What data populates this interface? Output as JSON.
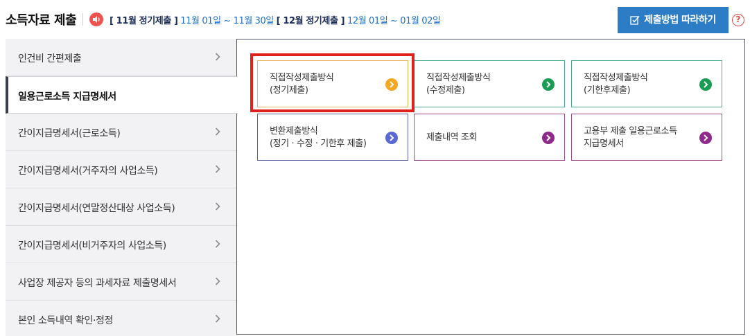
{
  "header": {
    "title": "소득자료 제출",
    "schedule": {
      "period1_label": "[ 11월 정기제출 ]",
      "period1_dates": "11월 01일 ~ 11월 30일",
      "period2_label": "[ 12월 정기제출 ]",
      "period2_dates": "12월 01일 ~ 01월 02일"
    },
    "guide_button_label": "제출방법 따라하기",
    "help_symbol": "?"
  },
  "sidebar": {
    "items": [
      {
        "label": "인건비 간편제출",
        "active": false
      },
      {
        "label": "일용근로소득 지급명세서",
        "active": true
      },
      {
        "label": "간이지급명세서(근로소득)",
        "active": false
      },
      {
        "label": "간이지급명세서(거주자의 사업소득)",
        "active": false
      },
      {
        "label": "간이지급명세서(연말정산대상 사업소득)",
        "active": false
      },
      {
        "label": "간이지급명세서(비거주자의 사업소득)",
        "active": false
      },
      {
        "label": "사업장 제공자 등의 과세자료 제출명세서",
        "active": false
      },
      {
        "label": "본인 소득내역 확인·정정",
        "active": false
      }
    ]
  },
  "cards": [
    {
      "line1": "직접작성제출방식",
      "line2": "(정기제출)",
      "icon": "chevron-right-icon",
      "color": "#f5a623"
    },
    {
      "line1": "직접작성제출방식",
      "line2": "(수정제출)",
      "icon": "chevron-right-icon",
      "color": "#1a9c55"
    },
    {
      "line1": "직접작성제출방식",
      "line2": "(기한후제출)",
      "icon": "chevron-right-icon",
      "color": "#1a9c55"
    },
    {
      "line1": "변환제출방식",
      "line2": "(정기 · 수정 · 기한후 제출)",
      "icon": "chevron-right-icon",
      "color": "#5b6ad1"
    },
    {
      "line1": "제출내역 조회",
      "line2": "",
      "icon": "chevron-right-icon",
      "color": "#8e2a8a"
    },
    {
      "line1": "고용부 제출 일용근로소득",
      "line2": "지급명세서",
      "icon": "chevron-right-icon",
      "color": "#8e2a8a"
    }
  ],
  "colors": {
    "accent_button": "#2d7cc6",
    "highlight": "#e0201b",
    "date_text": "#1d6fc4"
  }
}
